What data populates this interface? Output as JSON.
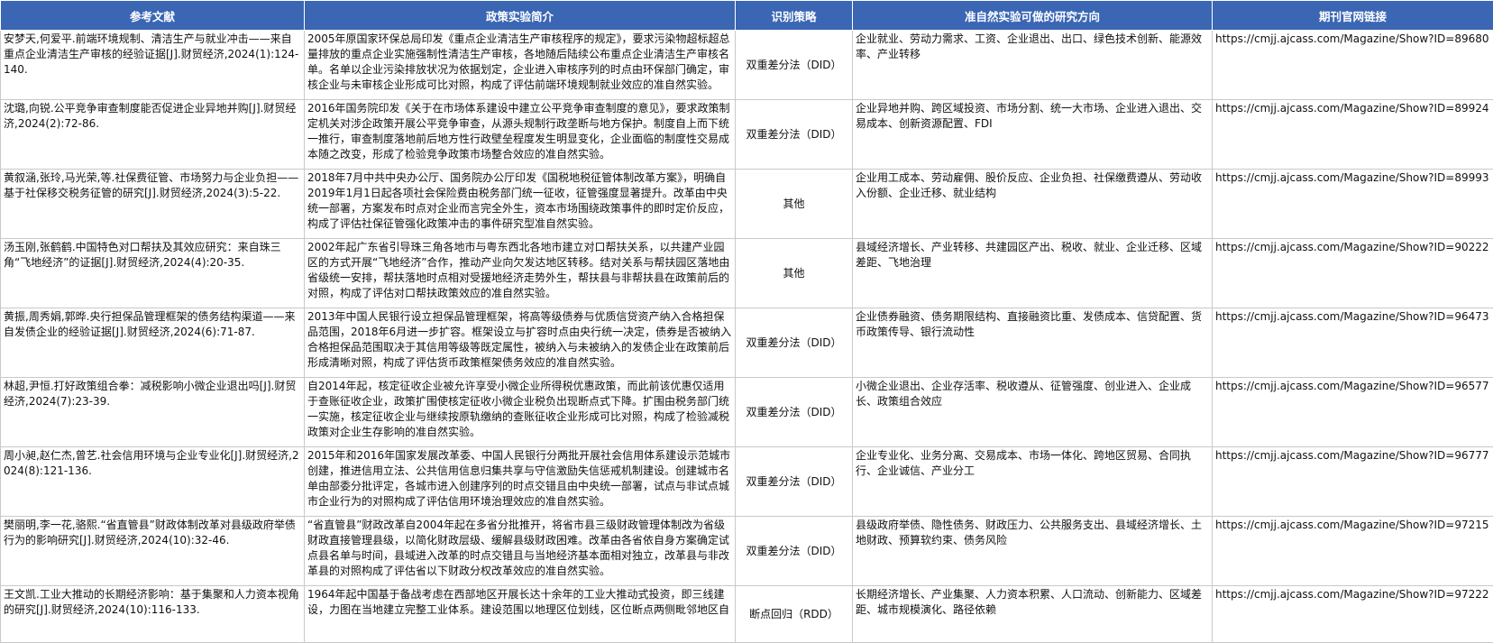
{
  "headers": [
    "参考文献",
    "政策实验简介",
    "识别策略",
    "准自然实验可做的研究方向",
    "期刊官网链接"
  ],
  "rows": [
    {
      "ref": "安梦天,何爱平.前端环境规制、清洁生产与就业冲击——来自重点企业清洁生产审核的经验证据[J].财贸经济,2024(1):124-140.",
      "intro": "2005年原国家环保总局印发《重点企业清洁生产审核程序的规定》，要求污染物超标超总量排放的重点企业实施强制性清洁生产审核，各地随后陆续公布重点企业清洁生产审核名单。名单以企业污染排放状况为依据划定，企业进入审核序列的时点由环保部门确定，审核企业与未审核企业形成可比对照，构成了评估前端环境规制就业效应的准自然实验。",
      "strategy": "双重差分法（DID）",
      "direction": "企业就业、劳动力需求、工资、企业退出、出口、绿色技术创新、能源效率、产业转移",
      "link": "https://cmjj.ajcass.com/Magazine/Show?ID=89680"
    },
    {
      "ref": "沈璐,向锐.公平竞争审查制度能否促进企业异地并购[J].财贸经济,2024(2):72-86.",
      "intro": "2016年国务院印发《关于在市场体系建设中建立公平竞争审查制度的意见》，要求政策制定机关对涉企政策开展公平竞争审查，从源头规制行政垄断与地方保护。制度自上而下统一推行，审查制度落地前后地方性行政壁垒程度发生明显变化，企业面临的制度性交易成本随之改变，形成了检验竞争政策市场整合效应的准自然实验。",
      "strategy": "双重差分法（DID）",
      "direction": "企业异地并购、跨区域投资、市场分割、统一大市场、企业进入退出、交易成本、创新资源配置、FDI",
      "link": "https://cmjj.ajcass.com/Magazine/Show?ID=89924"
    },
    {
      "ref": "黄叙涵,张玲,马光荣,等.社保费征管、市场努力与企业负担——基于社保移交税务征管的研究[J].财贸经济,2024(3):5-22.",
      "intro": "2018年7月中共中央办公厅、国务院办公厅印发《国税地税征管体制改革方案》，明确自2019年1月1日起各项社会保险费由税务部门统一征收，征管强度显著提升。改革由中央统一部署，方案发布时点对企业而言完全外生，资本市场围绕政策事件的即时定价反应，构成了评估社保征管强化政策冲击的事件研究型准自然实验。",
      "strategy": "其他",
      "direction": "企业用工成本、劳动雇佣、股价反应、企业负担、社保缴费遵从、劳动收入份额、企业迁移、就业结构",
      "link": "https://cmjj.ajcass.com/Magazine/Show?ID=89993"
    },
    {
      "ref": "汤玉刚,张鹤鹤.中国特色对口帮扶及其效应研究：来自珠三角“飞地经济”的证据[J].财贸经济,2024(4):20-35.",
      "intro": "2002年起广东省引导珠三角各地市与粤东西北各地市建立对口帮扶关系，以共建产业园区的方式开展“飞地经济”合作，推动产业向欠发达地区转移。结对关系与帮扶园区落地由省级统一安排，帮扶落地时点相对受援地经济走势外生，帮扶县与非帮扶县在政策前后的对照，构成了评估对口帮扶政策效应的准自然实验。",
      "strategy": "其他",
      "direction": "县域经济增长、产业转移、共建园区产出、税收、就业、企业迁移、区域差距、飞地治理",
      "link": "https://cmjj.ajcass.com/Magazine/Show?ID=90222"
    },
    {
      "ref": "黄振,周秀娟,郭晔.央行担保品管理框架的债务结构渠道——来自发债企业的经验证据[J].财贸经济,2024(6):71-87.",
      "intro": "2013年中国人民银行设立担保品管理框架，将高等级债券与优质信贷资产纳入合格担保品范围，2018年6月进一步扩容。框架设立与扩容时点由央行统一决定，债券是否被纳入合格担保品范围取决于其信用等级等既定属性，被纳入与未被纳入的发债企业在政策前后形成清晰对照，构成了评估货币政策框架债务效应的准自然实验。",
      "strategy": "双重差分法（DID）",
      "direction": "企业债券融资、债务期限结构、直接融资比重、发债成本、信贷配置、货币政策传导、银行流动性",
      "link": "https://cmjj.ajcass.com/Magazine/Show?ID=96473"
    },
    {
      "ref": "林超,尹恒.打好政策组合拳：减税影响小微企业退出吗[J].财贸经济,2024(7):23-39.",
      "intro": "自2014年起，核定征收企业被允许享受小微企业所得税优惠政策，而此前该优惠仅适用于查账征收企业，政策扩围使核定征收小微企业税负出现断点式下降。扩围由税务部门统一实施，核定征收企业与继续按原轨缴纳的查账征收企业形成可比对照，构成了检验减税政策对企业生存影响的准自然实验。",
      "strategy": "双重差分法（DID）",
      "direction": "小微企业退出、企业存活率、税收遵从、征管强度、创业进入、企业成长、政策组合效应",
      "link": "https://cmjj.ajcass.com/Magazine/Show?ID=96577"
    },
    {
      "ref": "周小昶,赵仁杰,曾艺.社会信用环境与企业专业化[J].财贸经济,2024(8):121-136.",
      "intro": "2015年和2016年国家发展改革委、中国人民银行分两批开展社会信用体系建设示范城市创建，推进信用立法、公共信用信息归集共享与守信激励失信惩戒机制建设。创建城市名单由部委分批评定，各城市进入创建序列的时点交错且由中央统一部署，试点与非试点城市企业行为的对照构成了评估信用环境治理效应的准自然实验。",
      "strategy": "双重差分法（DID）",
      "direction": "企业专业化、业务分离、交易成本、市场一体化、跨地区贸易、合同执行、企业诚信、产业分工",
      "link": "https://cmjj.ajcass.com/Magazine/Show?ID=96777"
    },
    {
      "ref": "樊丽明,李一花,骆熙.“省直管县”财政体制改革对县级政府举债行为的影响研究[J].财贸经济,2024(10):32-46.",
      "intro": "“省直管县”财政改革自2004年起在多省分批推开，将省市县三级财政管理体制改为省级财政直接管理县级，以简化财政层级、缓解县级财政困难。改革由各省依自身方案确定试点县名单与时间，县域进入改革的时点交错且与当地经济基本面相对独立，改革县与非改革县的对照构成了评估省以下财政分权改革效应的准自然实验。",
      "strategy": "双重差分法（DID）",
      "direction": "县级政府举债、隐性债务、财政压力、公共服务支出、县域经济增长、土地财政、预算软约束、债务风险",
      "link": "https://cmjj.ajcass.com/Magazine/Show?ID=97215"
    },
    {
      "ref": "王文凯.工业大推动的长期经济影响：基于集聚和人力资本视角的研究[J].财贸经济,2024(10):116-133.",
      "intro": "1964年起中国基于备战考虑在西部地区开展长达十余年的工业大推动式投资，即三线建设，力图在当地建立完整工业体系。建设范围以地理区位划线，区位断点两侧毗邻地区自",
      "strategy": "断点回归（RDD）",
      "direction": "长期经济增长、产业集聚、人力资本积累、人口流动、创新能力、区域差距、城市规模演化、路径依赖",
      "link": "https://cmjj.ajcass.com/Magazine/Show?ID=97222"
    }
  ]
}
